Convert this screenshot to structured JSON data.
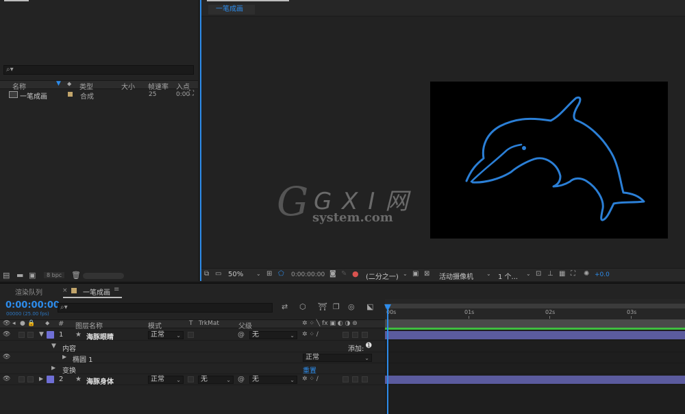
{
  "project": {
    "search_placeholder": "",
    "columns": {
      "name": "名称",
      "type": "类型",
      "size": "大小",
      "fps": "帧速率",
      "in": "入点"
    },
    "item": {
      "name": "一笔成画",
      "type": "合成",
      "fps": "25",
      "in": "0:00"
    },
    "footer": {
      "bpc": "8 bpc"
    }
  },
  "viewer": {
    "tab_label": "一笔成画",
    "watermark_main": "G X I 网",
    "watermark_sub": "system.com",
    "bar": {
      "zoom": "50%",
      "timecode": "0:00:00:00",
      "resolution": "(二分之一)",
      "camera": "活动摄像机",
      "views": "1 个...",
      "exposure": "+0.0"
    }
  },
  "timeline": {
    "tabs": {
      "render_queue": "渲染队列",
      "comp": "一笔成画"
    },
    "timecode": "0:00:00:00",
    "timecode_sub": "00000 (25.00 fps)",
    "search_placeholder": "",
    "ruler": [
      "00s",
      "01s",
      "02s",
      "03s"
    ],
    "header": {
      "num": "#",
      "layer_name": "图层名称",
      "mode": "模式",
      "t": "T",
      "trkmat": "TrkMat",
      "parent": "父级"
    },
    "layers": [
      {
        "num": "1",
        "name": "海豚眼睛",
        "mode": "正常",
        "trkmat": "",
        "parent": "无"
      },
      {
        "num": "2",
        "name": "海豚身体",
        "mode": "正常",
        "trkmat": "无",
        "parent": "无"
      }
    ],
    "sub": {
      "contents": "内容",
      "add": "添加:",
      "ellipse": "椭圆 1",
      "ellipse_mode": "正常",
      "transform": "变换",
      "reset": "重置"
    }
  },
  "colors": {
    "accent": "#2d8ceb",
    "label": "#6f6fd6",
    "bar": "#5b5b9e",
    "workarea": "#3fbf3f"
  }
}
